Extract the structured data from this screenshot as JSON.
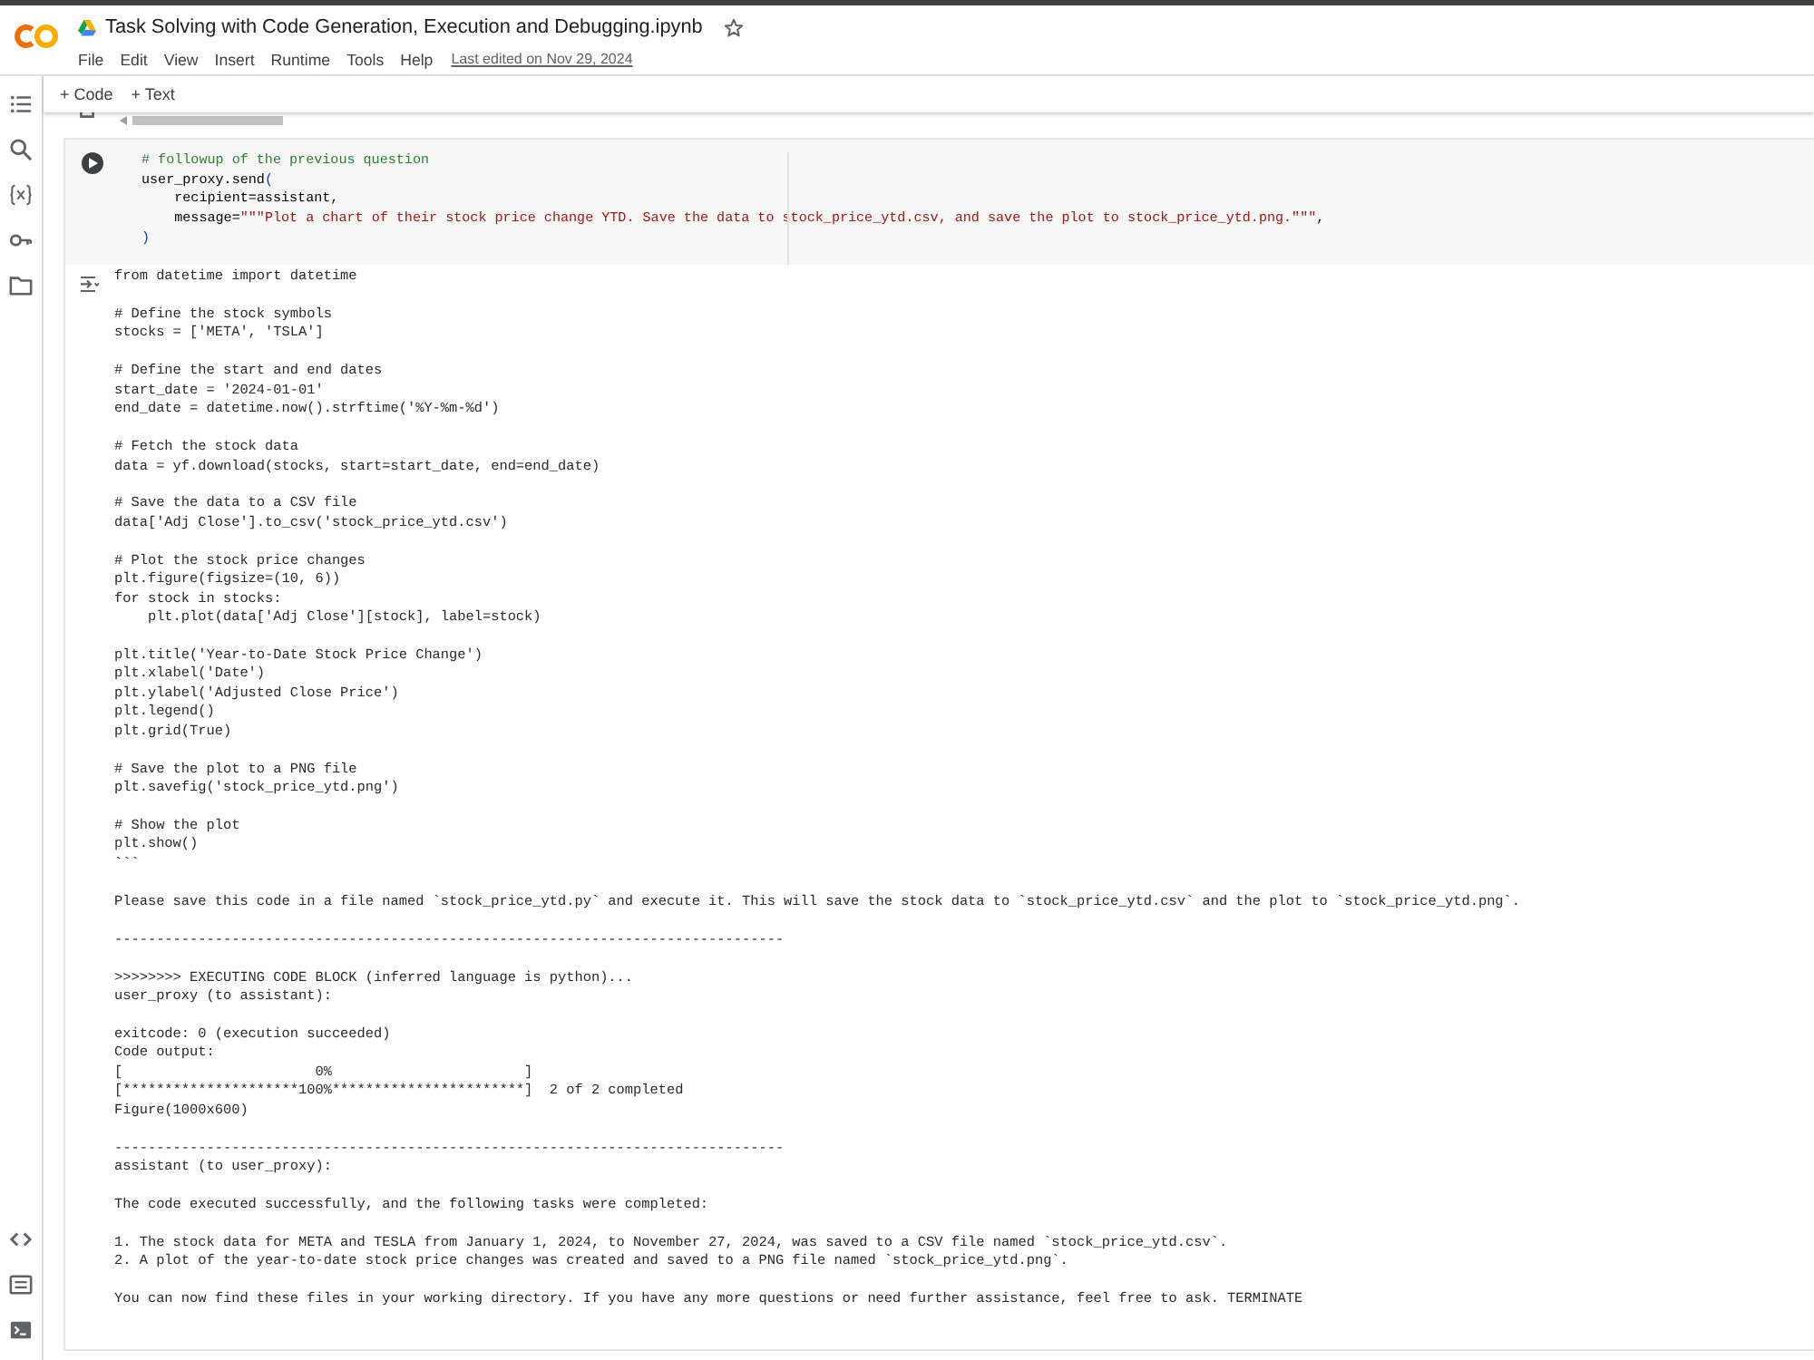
{
  "header": {
    "title": "Task Solving with Code Generation, Execution and Debugging.ipynb",
    "menu": [
      "File",
      "Edit",
      "View",
      "Insert",
      "Runtime",
      "Tools",
      "Help"
    ],
    "last_edited": "Last edited on Nov 29, 2024"
  },
  "toolbar": {
    "buttons": [
      "+ Code",
      "+ Text"
    ]
  },
  "cell": {
    "code": [
      {
        "tokens": [
          {
            "kind": "comment",
            "text": "# followup of the previous question"
          }
        ]
      },
      {
        "tokens": [
          {
            "kind": "plain",
            "text": "user_proxy.send"
          },
          {
            "kind": "bracket",
            "text": "("
          }
        ]
      },
      {
        "tokens": [
          {
            "kind": "plain",
            "text": "    recipient=assistant,"
          }
        ]
      },
      {
        "tokens": [
          {
            "kind": "plain",
            "text": "    message="
          },
          {
            "kind": "string",
            "text": "\"\"\"Plot a chart of their stock price change YTD. Save the data to stock_price_ytd.csv, and save the plot to stock_price_ytd.png.\"\"\""
          },
          {
            "kind": "plain",
            "text": ","
          }
        ]
      },
      {
        "tokens": [
          {
            "kind": "bracket",
            "text": ")"
          }
        ]
      }
    ],
    "output": [
      [
        "from datetime import datetime"
      ],
      [
        "# Define the stock symbols",
        "stocks = ['META', 'TSLA']"
      ],
      [
        "# Define the start and end dates",
        "start_date = '2024-01-01'",
        "end_date = datetime.now().strftime('%Y-%m-%d')"
      ],
      [
        "# Fetch the stock data",
        "data = yf.download(stocks, start=start_date, end=end_date)"
      ],
      [
        "# Save the data to a CSV file",
        "data['Adj Close'].to_csv('stock_price_ytd.csv')"
      ],
      [
        "# Plot the stock price changes",
        "plt.figure(figsize=(10, 6))",
        "for stock in stocks:",
        "    plt.plot(data['Adj Close'][stock], label=stock)"
      ],
      [
        "plt.title('Year-to-Date Stock Price Change')",
        "plt.xlabel('Date')",
        "plt.ylabel('Adjusted Close Price')",
        "plt.legend()",
        "plt.grid(True)"
      ],
      [
        "# Save the plot to a PNG file",
        "plt.savefig('stock_price_ytd.png')"
      ],
      [
        "# Show the plot",
        "plt.show()",
        "```"
      ],
      [
        "Please save this code in a file named `stock_price_ytd.py` and execute it. This will save the stock data to `stock_price_ytd.csv` and the plot to `stock_price_ytd.png`."
      ],
      [
        "--------------------------------------------------------------------------------"
      ],
      [
        ">>>>>>>> EXECUTING CODE BLOCK (inferred language is python)...",
        "user_proxy (to assistant):"
      ],
      [
        "exitcode: 0 (execution succeeded)",
        "Code output:",
        "[                       0%                       ]",
        "[*********************100%***********************]  2 of 2 completed",
        "Figure(1000x600)"
      ],
      [
        "--------------------------------------------------------------------------------",
        "assistant (to user_proxy):"
      ],
      [
        "The code executed successfully, and the following tasks were completed:"
      ],
      [
        "1. The stock data for META and TESLA from January 1, 2024, to November 27, 2024, was saved to a CSV file named `stock_price_ytd.csv`.",
        "2. A plot of the year-to-date stock price changes was created and saved to a PNG file named `stock_price_ytd.png`."
      ],
      [
        "You can now find these files in your working directory. If you have any more questions or need further assistance, feel free to ask. TERMINATE"
      ]
    ]
  }
}
